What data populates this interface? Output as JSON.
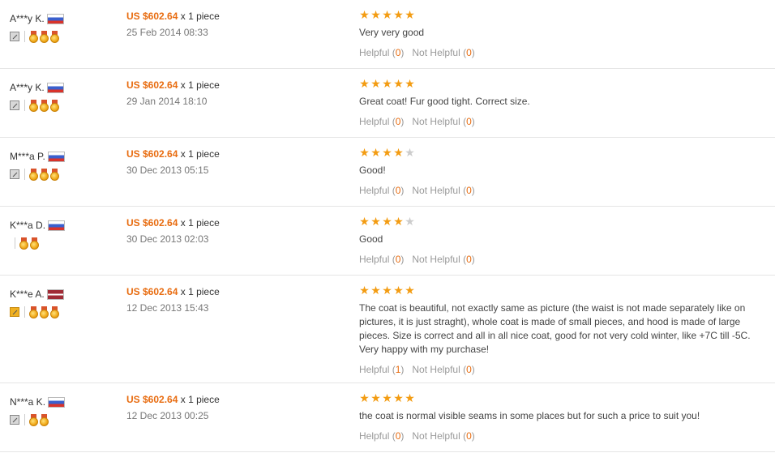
{
  "colors": {
    "price": "#e86c10",
    "star": "#f39c12",
    "star_empty": "#cccccc",
    "divider": "#e5e5e5"
  },
  "reviews": [
    {
      "buyer": "A***y K.",
      "flag": "ru-flag",
      "feedback_icon": "feedback-pencil-icon",
      "feedback_active": false,
      "medals": 3,
      "price": "US $602.64",
      "qty": "x 1 piece",
      "date": "25 Feb 2014 08:33",
      "rating": 5,
      "text": "Very very good",
      "helpful_label": "Helpful",
      "helpful_count": "0",
      "not_helpful_label": "Not Helpful",
      "not_helpful_count": "0"
    },
    {
      "buyer": "A***y K.",
      "flag": "ru-flag",
      "feedback_icon": "feedback-pencil-icon",
      "feedback_active": false,
      "medals": 3,
      "price": "US $602.64",
      "qty": "x 1 piece",
      "date": "29 Jan 2014 18:10",
      "rating": 5,
      "text": "Great coat! Fur good tight. Correct size.",
      "helpful_label": "Helpful",
      "helpful_count": "0",
      "not_helpful_label": "Not Helpful",
      "not_helpful_count": "0"
    },
    {
      "buyer": "M***a P.",
      "flag": "ru-flag",
      "feedback_icon": "feedback-pencil-icon",
      "feedback_active": false,
      "medals": 3,
      "price": "US $602.64",
      "qty": "x 1 piece",
      "date": "30 Dec 2013 05:15",
      "rating": 4,
      "text": "Good!",
      "helpful_label": "Helpful",
      "helpful_count": "0",
      "not_helpful_label": "Not Helpful",
      "not_helpful_count": "0"
    },
    {
      "buyer": "K***a D.",
      "flag": "ru-flag",
      "feedback_icon": null,
      "feedback_active": false,
      "medals": 2,
      "price": "US $602.64",
      "qty": "x 1 piece",
      "date": "30 Dec 2013 02:03",
      "rating": 4,
      "text": "Good",
      "helpful_label": "Helpful",
      "helpful_count": "0",
      "not_helpful_label": "Not Helpful",
      "not_helpful_count": "0"
    },
    {
      "buyer": "K***e A.",
      "flag": "lv-flag",
      "feedback_icon": "feedback-pencil-icon",
      "feedback_active": true,
      "medals": 3,
      "price": "US $602.64",
      "qty": "x 1 piece",
      "date": "12 Dec 2013 15:43",
      "rating": 5,
      "text": "The coat is beautiful, not exactly same as picture (the waist is not made separately like on pictures, it is just straght), whole coat is made of small pieces, and hood is made of large pieces. Size is correct and all in all nice coat, good for not very cold winter, like +7C till -5C. Very happy with my purchase!",
      "helpful_label": "Helpful",
      "helpful_count": "1",
      "not_helpful_label": "Not Helpful",
      "not_helpful_count": "0"
    },
    {
      "buyer": "N***a K.",
      "flag": "ru-flag",
      "feedback_icon": "feedback-pencil-icon",
      "feedback_active": false,
      "medals": 2,
      "price": "US $602.64",
      "qty": "x 1 piece",
      "date": "12 Dec 2013 00:25",
      "rating": 5,
      "text": "the coat is normal visible seams in some places but for such a price to suit you!",
      "helpful_label": "Helpful",
      "helpful_count": "0",
      "not_helpful_label": "Not Helpful",
      "not_helpful_count": "0"
    }
  ]
}
